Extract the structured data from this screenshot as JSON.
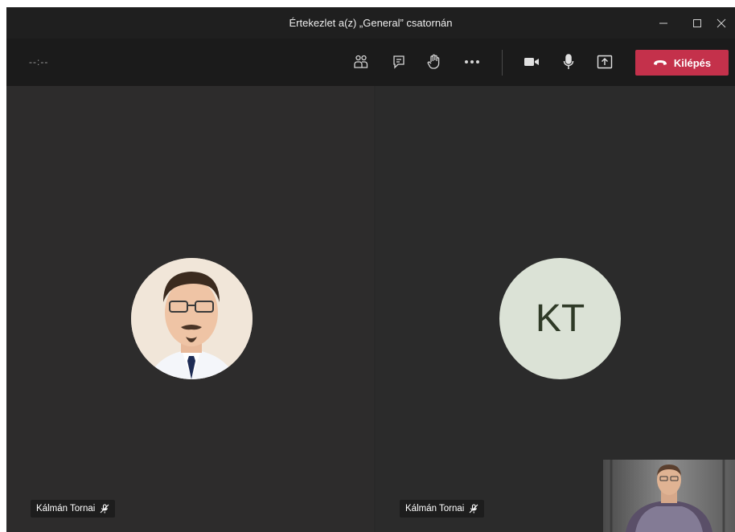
{
  "window": {
    "title": "Értekezlet a(z) „General” csatornán"
  },
  "toolbar": {
    "timer": "--:--",
    "leave_label": "Kilépés",
    "icons": [
      "participants-icon",
      "chat-icon",
      "raise-hand-icon",
      "more-options-icon",
      "camera-icon",
      "microphone-icon",
      "share-screen-icon"
    ]
  },
  "tiles": [
    {
      "name": "Kálmán Tornai",
      "avatar": "photo",
      "muted": true
    },
    {
      "name": "Kálmán Tornai",
      "avatar": "initials",
      "initials": "KT",
      "muted": true
    }
  ],
  "colors": {
    "leave": "#c4314b",
    "initials_bg": "#dbe2d6",
    "stage_bg": "#292929"
  }
}
